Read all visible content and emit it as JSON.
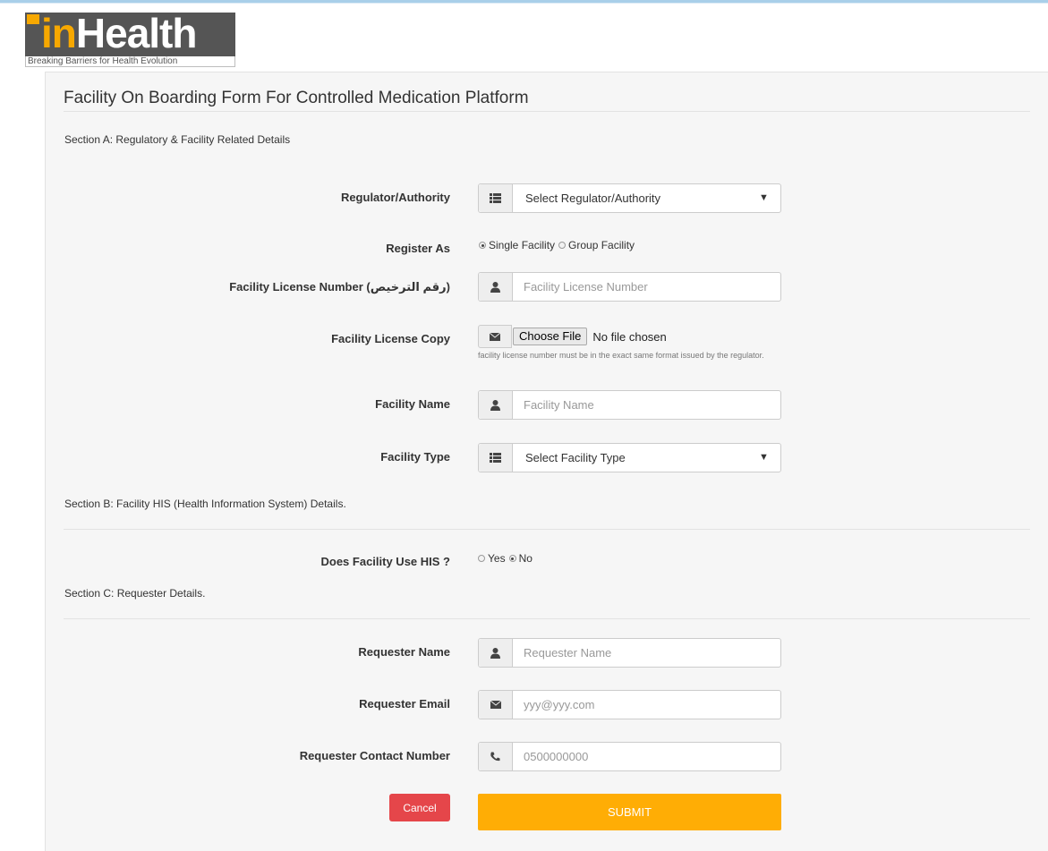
{
  "logo": {
    "mark_in": "in",
    "mark_health": "Health",
    "tagline": "Breaking Barriers for Health Evolution"
  },
  "form": {
    "title": "Facility On Boarding Form For Controlled Medication Platform"
  },
  "section_a": {
    "title": "Section A: Regulatory & Facility Related Details",
    "regulator_label": "Regulator/Authority",
    "regulator_selected": "Select Regulator/Authority",
    "register_as_label": "Register As",
    "register_as_options": [
      "Single Facility",
      "Group Facility"
    ],
    "register_as_selected": "Single Facility",
    "license_number_label": "Facility License Number (رقم الترخيص)",
    "license_number_placeholder": "Facility License Number",
    "license_copy_label": "Facility License Copy",
    "file_button": "Choose File",
    "file_status": "No file chosen",
    "license_help": "facility license number must be in the exact same format issued by the regulator.",
    "facility_name_label": "Facility Name",
    "facility_name_placeholder": "Facility Name",
    "facility_type_label": "Facility Type",
    "facility_type_selected": "Select Facility Type"
  },
  "section_b": {
    "title": "Section B: Facility HIS (Health Information System) Details.",
    "his_label": "Does Facility Use HIS ?",
    "his_options": [
      "Yes",
      "No"
    ],
    "his_selected": "No"
  },
  "section_c": {
    "title": "Section C: Requester Details.",
    "requester_name_label": "Requester Name",
    "requester_name_placeholder": "Requester Name",
    "requester_email_label": "Requester Email",
    "requester_email_placeholder": "yyy@yyy.com",
    "requester_contact_label": "Requester Contact Number",
    "requester_contact_placeholder": "0500000000"
  },
  "actions": {
    "cancel_label": "Cancel",
    "submit_label": "SUBMIT"
  },
  "colors": {
    "brand_orange": "#f7a800",
    "submit": "#ffad05",
    "cancel": "#e5464a",
    "logo_dark": "#555555"
  },
  "icons": {
    "list": "list-icon",
    "user": "user-icon",
    "envelope": "envelope-icon",
    "phone": "phone-icon"
  }
}
